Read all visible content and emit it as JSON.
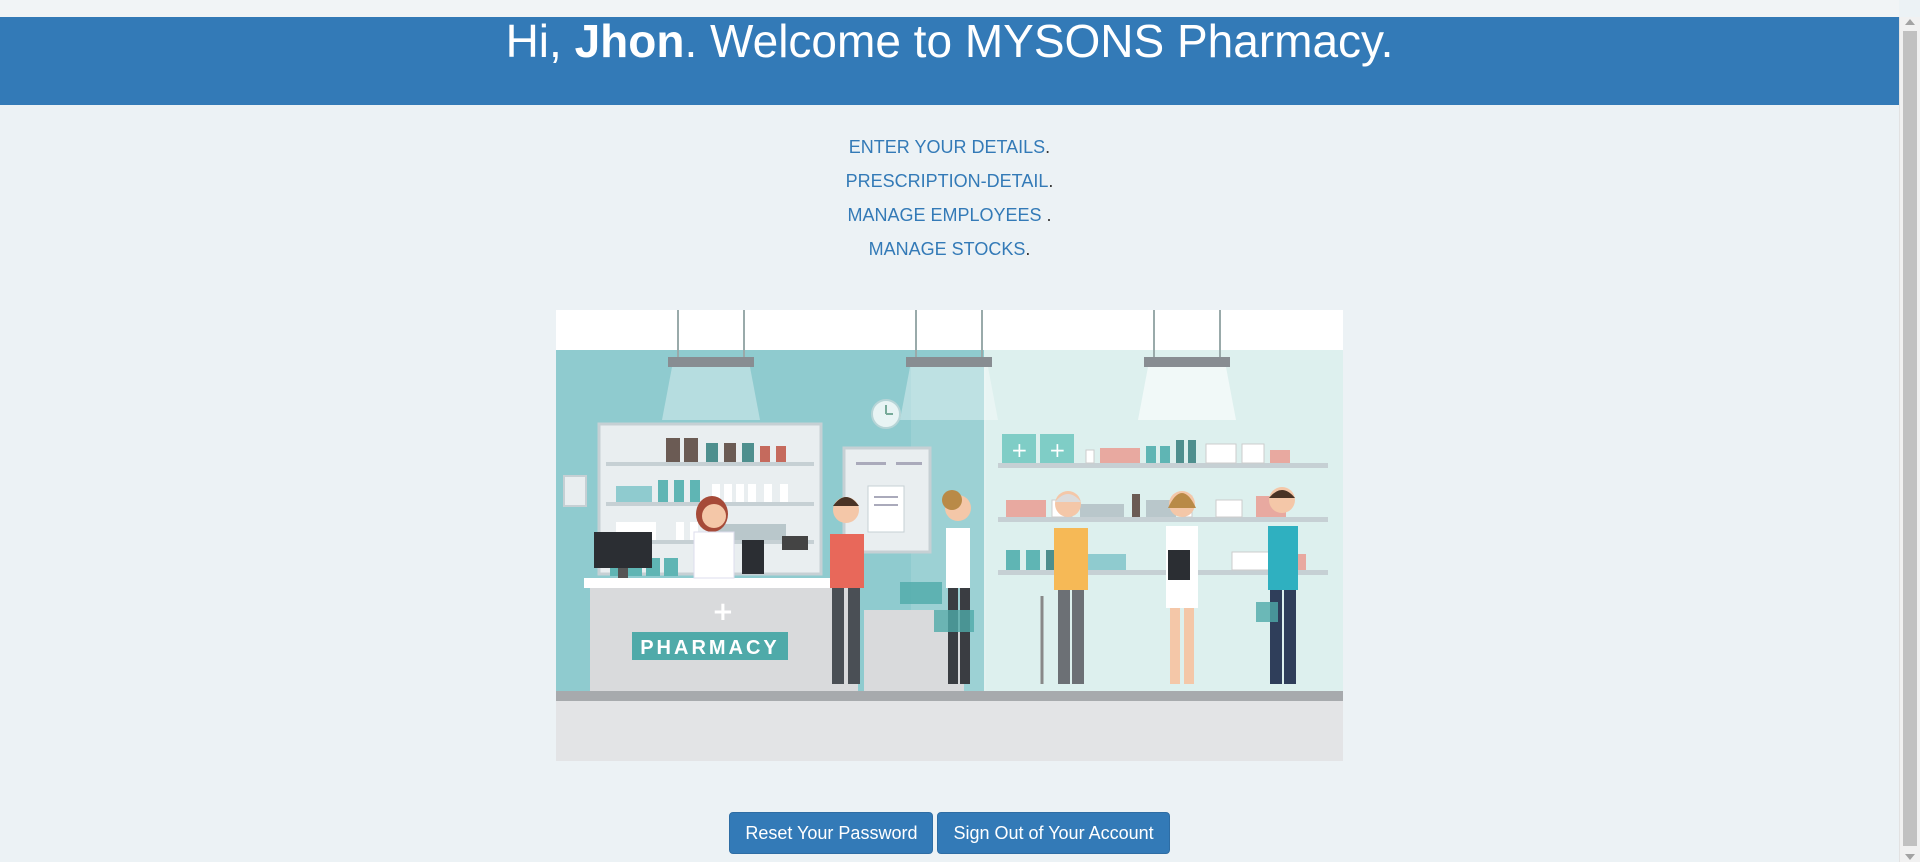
{
  "header": {
    "greeting": "Hi, ",
    "user_name": "Jhon",
    "welcome": ". Welcome to MYSONS Pharmacy."
  },
  "menu": {
    "items": [
      {
        "label": "ENTER YOUR DETAILS",
        "suffix": "."
      },
      {
        "label": "PRESCRIPTION-DETAIL",
        "suffix": "."
      },
      {
        "label": "MANAGE EMPLOYEES ",
        "suffix": "."
      },
      {
        "label": "MANAGE STOCKS",
        "suffix": "."
      }
    ]
  },
  "illustration": {
    "sign_text": "PHARMACY"
  },
  "buttons": {
    "reset_password": "Reset Your Password",
    "sign_out": "Sign Out of Your Account"
  },
  "colors": {
    "header_bg": "#337ab7",
    "page_bg": "#ecf2f5",
    "link": "#337ab7"
  }
}
